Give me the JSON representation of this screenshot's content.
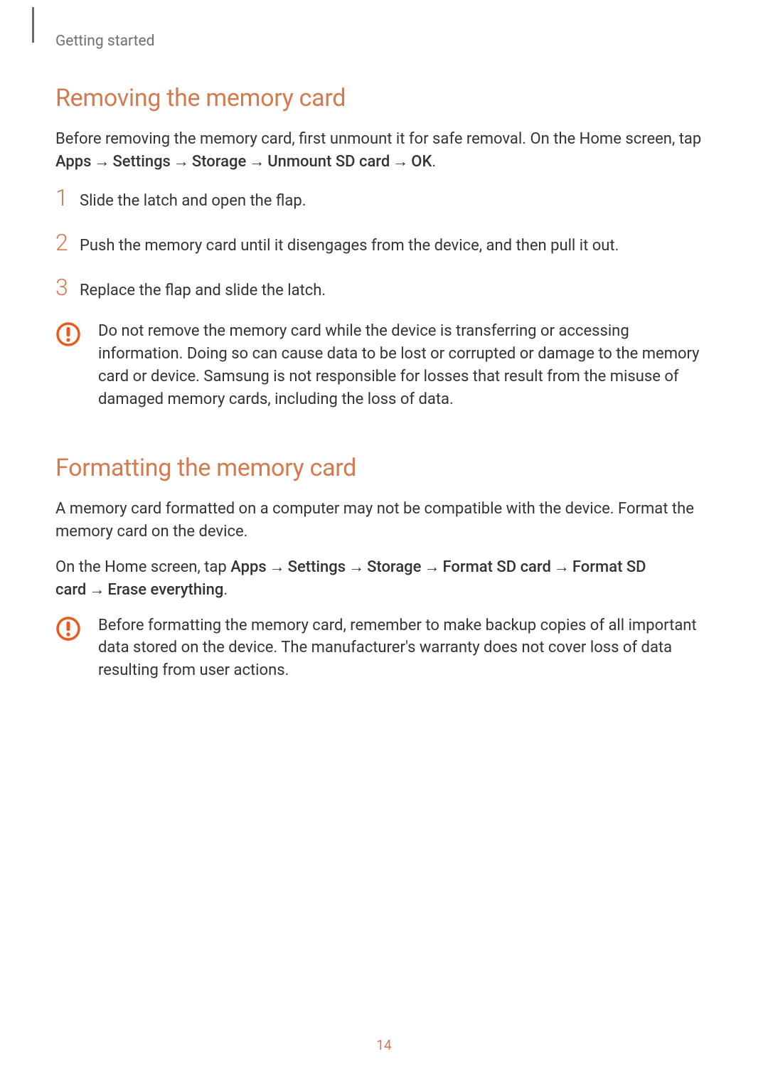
{
  "breadcrumb": "Getting started",
  "page_number": "14",
  "arrow": "→",
  "section1": {
    "heading": "Removing the memory card",
    "intro_pre": "Before removing the memory card, first unmount it for safe removal. On the Home screen, tap ",
    "nav": {
      "a": "Apps",
      "b": "Settings",
      "c": "Storage",
      "d": "Unmount SD card",
      "e": "OK"
    },
    "intro_post": ".",
    "steps": [
      {
        "num": "1",
        "text": "Slide the latch and open the flap."
      },
      {
        "num": "2",
        "text": "Push the memory card until it disengages from the device, and then pull it out."
      },
      {
        "num": "3",
        "text": "Replace the flap and slide the latch."
      }
    ],
    "warning": "Do not remove the memory card while the device is transferring or accessing information. Doing so can cause data to be lost or corrupted or damage to the memory card or device. Samsung is not responsible for losses that result from the misuse of damaged memory cards, including the loss of data."
  },
  "section2": {
    "heading": "Formatting the memory card",
    "para1": "A memory card formatted on a computer may not be compatible with the device. Format the memory card on the device.",
    "para2_pre": "On the Home screen, tap ",
    "nav": {
      "a": "Apps",
      "b": "Settings",
      "c": "Storage",
      "d": "Format SD card",
      "e": "Format SD card",
      "f": "Erase everything"
    },
    "para2_post": ".",
    "warning": "Before formatting the memory card, remember to make backup copies of all important data stored on the device. The manufacturer's warranty does not cover loss of data resulting from user actions."
  }
}
